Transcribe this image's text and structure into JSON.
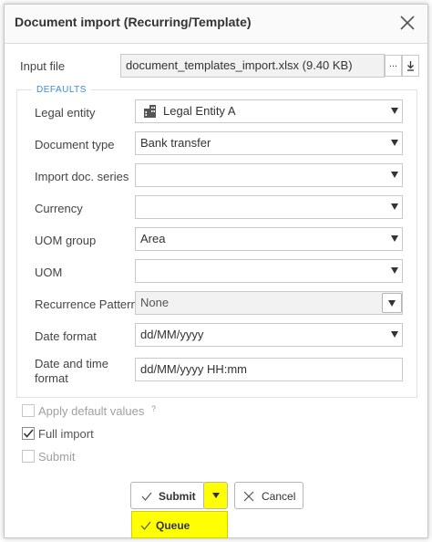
{
  "dialog": {
    "title": "Document import (Recurring/Template)"
  },
  "input_file": {
    "label": "Input file",
    "value": "document_templates_import.xlsx (9.40 KB)",
    "browse_label": "...",
    "download_icon": "download-icon"
  },
  "defaults": {
    "legend": "DEFAULTS",
    "legal_entity": {
      "label": "Legal entity",
      "value": "Legal Entity A",
      "icon": "building-icon"
    },
    "document_type": {
      "label": "Document type",
      "value": "Bank transfer"
    },
    "import_doc_series": {
      "label": "Import doc. series",
      "value": ""
    },
    "currency": {
      "label": "Currency",
      "value": ""
    },
    "uom_group": {
      "label": "UOM group",
      "value": "Area"
    },
    "uom": {
      "label": "UOM",
      "value": ""
    },
    "recurrence_pattern": {
      "label": "Recurrence Pattern",
      "value": "None"
    },
    "date_format": {
      "label": "Date format",
      "value": "dd/MM/yyyy"
    },
    "date_time_format": {
      "label_line1": "Date and time",
      "label_line2": "format",
      "value": "dd/MM/yyyy HH:mm"
    }
  },
  "options": {
    "apply_default_values": {
      "label": "Apply default values",
      "checked": false,
      "help_icon": "?"
    },
    "full_import": {
      "label": "Full import",
      "checked": true
    },
    "submit": {
      "label": "Submit",
      "checked": false
    }
  },
  "actions": {
    "submit_label": "Submit",
    "cancel_label": "Cancel",
    "queue_label": "Queue",
    "highlight_color": "#ffff00"
  }
}
